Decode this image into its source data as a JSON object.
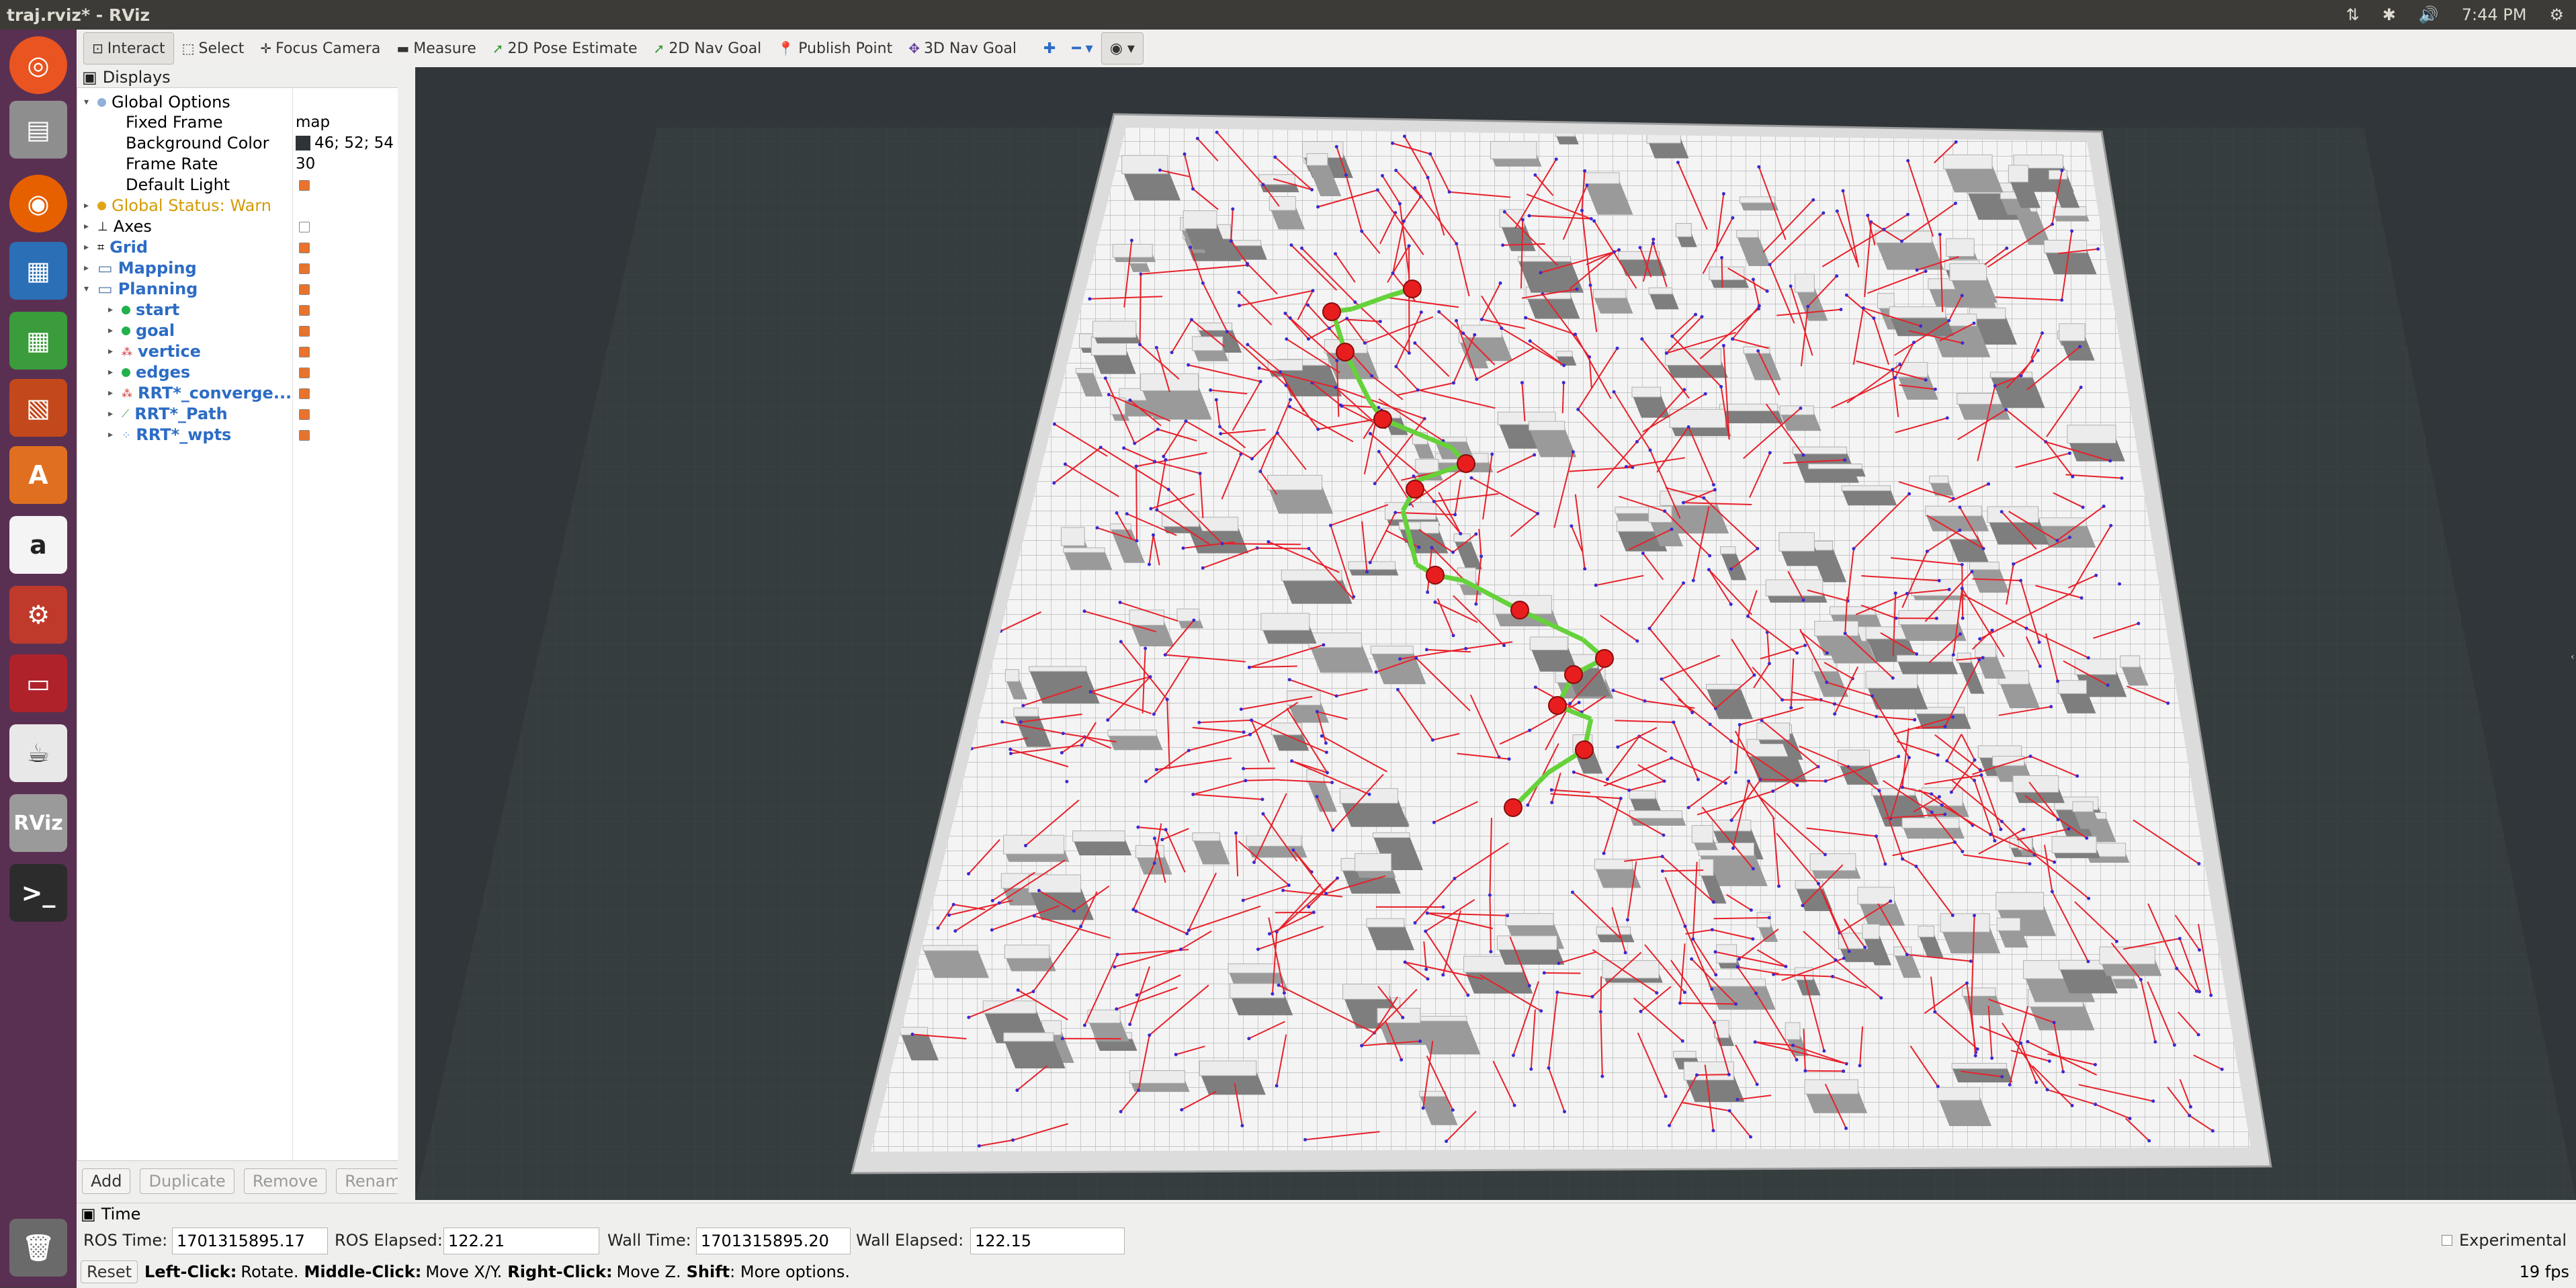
{
  "window": {
    "title": "traj.rviz* - RViz"
  },
  "system_tray": {
    "time": "7:44 PM"
  },
  "toolbar": {
    "tools": [
      "Interact",
      "Select",
      "Focus Camera",
      "Measure",
      "2D Pose Estimate",
      "2D Nav Goal",
      "Publish Point",
      "3D Nav Goal"
    ]
  },
  "displays": {
    "title": "Displays",
    "global_options": "Global Options",
    "fixed_frame_label": "Fixed Frame",
    "fixed_frame_value": "map",
    "bg_color_label": "Background Color",
    "bg_color_value": "46; 52; 54",
    "frame_rate_label": "Frame Rate",
    "frame_rate_value": "30",
    "default_light_label": "Default Light",
    "global_status": "Global Status: Warn",
    "axes": "Axes",
    "grid": "Grid",
    "mapping": "Mapping",
    "planning": "Planning",
    "planning_children": [
      "start",
      "goal",
      "vertice",
      "edges",
      "RRT*_converge...",
      "RRT*_Path",
      "RRT*_wpts"
    ],
    "buttons": {
      "add": "Add",
      "duplicate": "Duplicate",
      "remove": "Remove",
      "rename": "Rename"
    }
  },
  "time_panel": {
    "title": "Time",
    "ros_time_label": "ROS Time:",
    "ros_time": "1701315895.17",
    "ros_elapsed_label": "ROS Elapsed:",
    "ros_elapsed": "122.21",
    "wall_time_label": "Wall Time:",
    "wall_time": "1701315895.20",
    "wall_elapsed_label": "Wall Elapsed:",
    "wall_elapsed": "122.15",
    "experimental": "Experimental"
  },
  "status_bar": {
    "reset": "Reset",
    "left_click": "Left-Click:",
    "left_click_desc": "Rotate.",
    "middle_click": "Middle-Click:",
    "middle_click_desc": "Move X/Y.",
    "right_click": "Right-Click:",
    "right_click_desc": "Move Z.",
    "shift": "Shift",
    "shift_desc": ": More options.",
    "fps": "19 fps"
  },
  "colors": {
    "background": "#2e3436",
    "edges": "#e8202a",
    "path": "#66d23b",
    "waypoints": "#e81e1e",
    "occupied": "#8a8a8a",
    "free": "#f4f4f4"
  }
}
